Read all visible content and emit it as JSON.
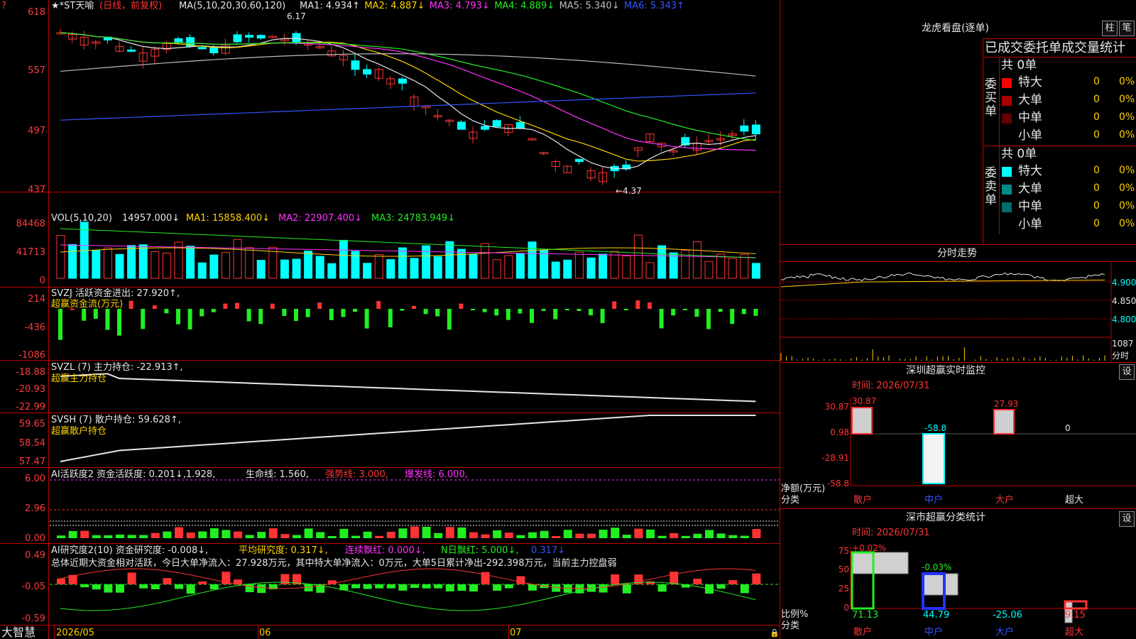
{
  "main": {
    "title_stock": "★*ST天喻",
    "title_mode": "(日线，前复权)",
    "ma_header": "MA(5,10,20,30,60,120)",
    "ma_values": [
      {
        "label": "MA1: 4.934↑",
        "color": "#e6e6e6"
      },
      {
        "label": "MA2: 4.887↓",
        "color": "#ffd200"
      },
      {
        "label": "MA3: 4.793↓",
        "color": "#ff33ff"
      },
      {
        "label": "MA4: 4.889↓",
        "color": "#22ee22"
      },
      {
        "label": "MA5: 5.340↓",
        "color": "#bdbdbd"
      },
      {
        "label": "MA6: 5.343↑",
        "color": "#3355ff"
      }
    ],
    "y_ticks": [
      "618",
      "557",
      "497",
      "437"
    ],
    "high_mark": "6.17",
    "low_mark": "←4.37"
  },
  "vol": {
    "header": "VOL(5,10,20)",
    "v0": "14957.000↓",
    "ma1": "MA1: 15858.400↓",
    "ma2": "MA2: 22907.400↓",
    "ma3": "MA3: 24783.949↓",
    "y_ticks": [
      "84468",
      "41713",
      "0"
    ]
  },
  "svzj": {
    "header": "SVZJ  活跃资金进出: 27.920↑,",
    "sub": "超赢资金流(万元)",
    "y_ticks": [
      "214",
      "-436",
      "-1086"
    ]
  },
  "svzl": {
    "header": "SVZL (7) 主力持仓: -22.913↑,",
    "sub": "超赢主力持仓",
    "y_ticks": [
      "-18.88",
      "-20.93",
      "-22.99"
    ]
  },
  "svsh": {
    "header": "SVSH (7) 散户持仓: 59.628↑,",
    "sub": "超赢散户持仓",
    "y_ticks": [
      "59.65",
      "58.54",
      "57.47"
    ]
  },
  "ai1": {
    "header_a": "AI活跃度2 资金活跃度: 0.201↓,1.928,",
    "header_b": "生命线: 1.560,",
    "header_c": "强势线: 3.000,",
    "header_d": "爆发线: 6.000,",
    "y_ticks": [
      "6.00",
      "2.96",
      "0.00"
    ]
  },
  "ai2": {
    "header_a": "AI研究度2(10) 资金研究度: -0.008↓,",
    "header_b": "平均研究度: 0.317↓,",
    "header_c": "连续飘红: 0.000↓,",
    "header_d": "N日飘红: 5.000↓,",
    "header_e": "0.317↓",
    "summary": "总体近期大资金相对活跃，今日大单净流入：27.928万元，其中特大单净流入：0万元，大单5日累计净出-292.398万元，当前主力控盘弱",
    "y_ticks": [
      "0.49",
      "-0.05",
      "-0.59"
    ]
  },
  "footer": {
    "brand": "大智慧",
    "dates": [
      "2026/05",
      "06",
      "07"
    ]
  },
  "right": {
    "lhb_title": "龙虎看盘(逐单)",
    "btn_zhu": "柱",
    "btn_bi": "笔",
    "tabs_label": "已成交委托单成交量统计",
    "buy_label": "委买单",
    "sell_label": "委卖单",
    "buy_total": "共 0单",
    "sell_total": "共 0单",
    "buy_rows": [
      {
        "name": "特大",
        "val": "0",
        "pct": "0%",
        "color": "#ff0000"
      },
      {
        "name": "大单",
        "val": "0",
        "pct": "0%",
        "color": "#aa0000"
      },
      {
        "name": "中单",
        "val": "0",
        "pct": "0%",
        "color": "#660000"
      },
      {
        "name": "小单",
        "val": "0",
        "pct": "0%",
        "color": "#000000"
      }
    ],
    "sell_rows": [
      {
        "name": "特大",
        "val": "0",
        "pct": "0%",
        "color": "#00ffff"
      },
      {
        "name": "大单",
        "val": "0",
        "pct": "0%",
        "color": "#008b8b"
      },
      {
        "name": "中单",
        "val": "0",
        "pct": "0%",
        "color": "#006d6d"
      },
      {
        "name": "小单",
        "val": "0",
        "pct": "0%",
        "color": "#000000"
      }
    ],
    "fs_title": "分时走势",
    "fs_ticks": [
      "4.900",
      "4.850",
      "4.800"
    ],
    "fs_vol": "1087",
    "fs_vol_label": "分时",
    "sz_title": "深圳超赢实时监控",
    "sz_btn": "设",
    "sz_time": "时间: 2026/07/31",
    "sz_ticks": [
      "30.87",
      "0.98",
      "-28.91",
      "-58.8"
    ],
    "sz_bar_vals": [
      "30.87",
      "-58.8",
      "27.93",
      "0"
    ],
    "sz_unit": "净额(万元)",
    "sz_cat_label": "分类",
    "sz_cats": [
      "散户",
      "中户",
      "大户",
      "超大"
    ],
    "cls_title": "深市超赢分类统计",
    "cls_btn": "设",
    "cls_time": "时间: 2026/07/31",
    "cls_ticks": [
      "75",
      "50",
      "25",
      "0"
    ],
    "cls_top_vals": [
      "+0.02%",
      "-0.03%"
    ],
    "cls_vals": [
      "71.13",
      "44.79",
      "-25.06",
      "9.15"
    ],
    "cls_unit": "比例%",
    "cls_cat_label": "分类",
    "cls_cats": [
      "散户",
      "中户",
      "大户",
      "超大"
    ]
  }
}
